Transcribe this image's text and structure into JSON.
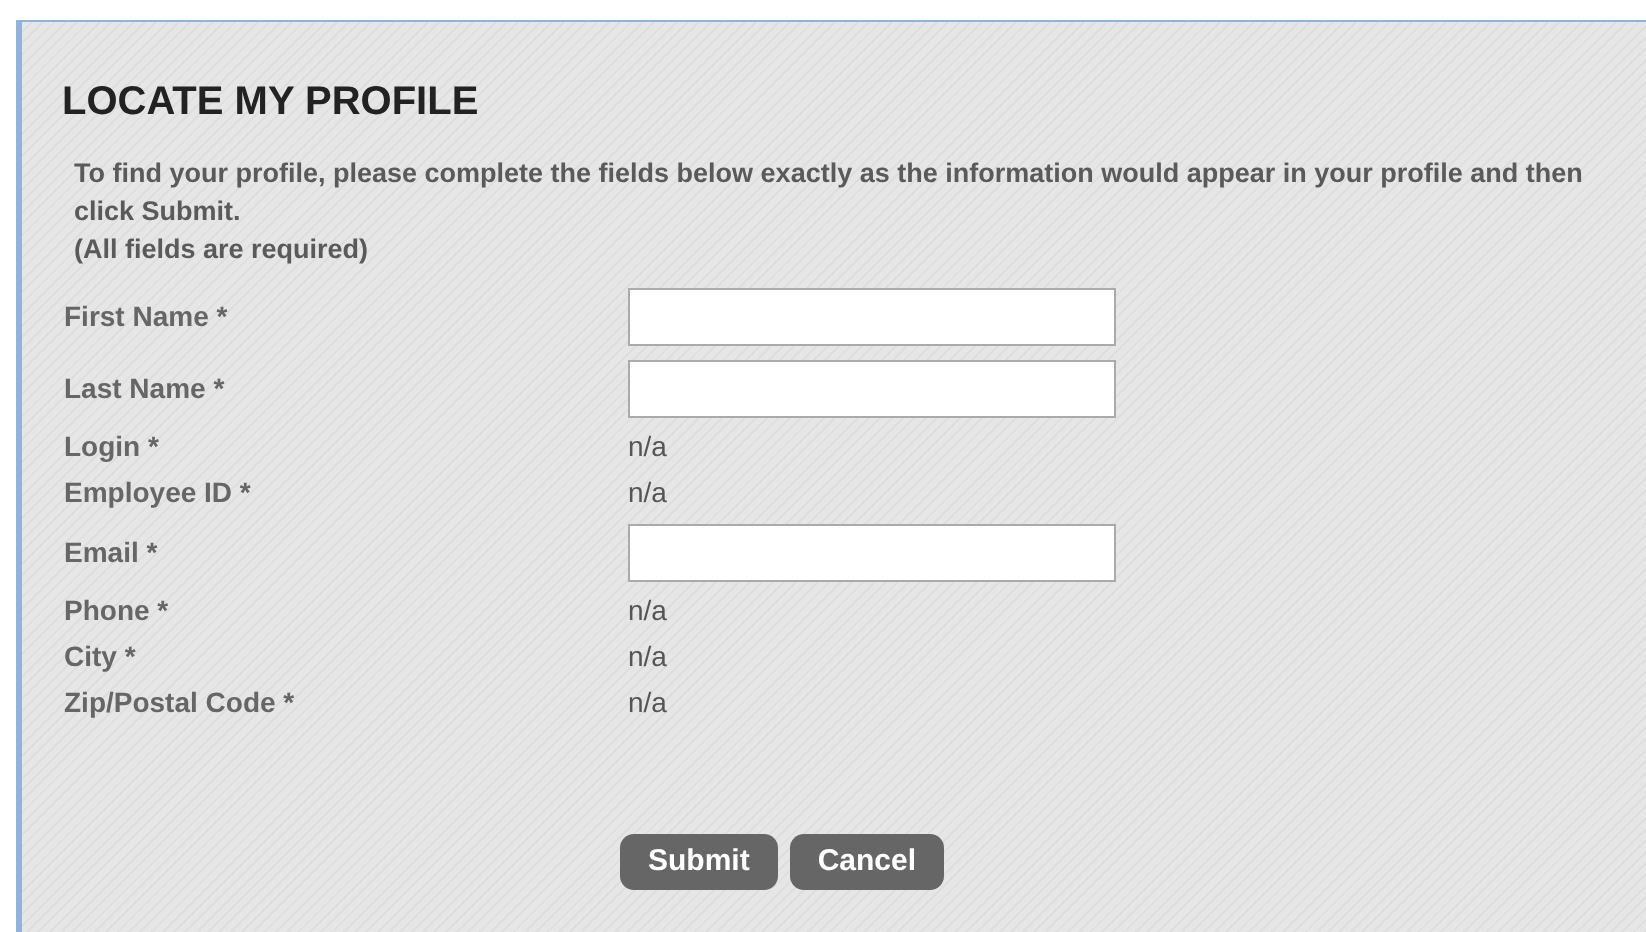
{
  "title": "LOCATE MY PROFILE",
  "instructions": "To find your profile, please complete the fields below exactly as the information would appear in your profile and then click Submit.",
  "required_note": "(All fields are required)",
  "fields": [
    {
      "label": "First Name *",
      "kind": "input"
    },
    {
      "label": "Last Name *",
      "kind": "input"
    },
    {
      "label": "Login *",
      "kind": "text",
      "value": "n/a"
    },
    {
      "label": "Employee ID *",
      "kind": "text",
      "value": "n/a"
    },
    {
      "label": "Email *",
      "kind": "input"
    },
    {
      "label": "Phone *",
      "kind": "text",
      "value": "n/a"
    },
    {
      "label": "City *",
      "kind": "text",
      "value": "n/a"
    },
    {
      "label": "Zip/Postal Code *",
      "kind": "text",
      "value": "n/a"
    }
  ],
  "buttons": [
    "Submit",
    "Cancel"
  ]
}
